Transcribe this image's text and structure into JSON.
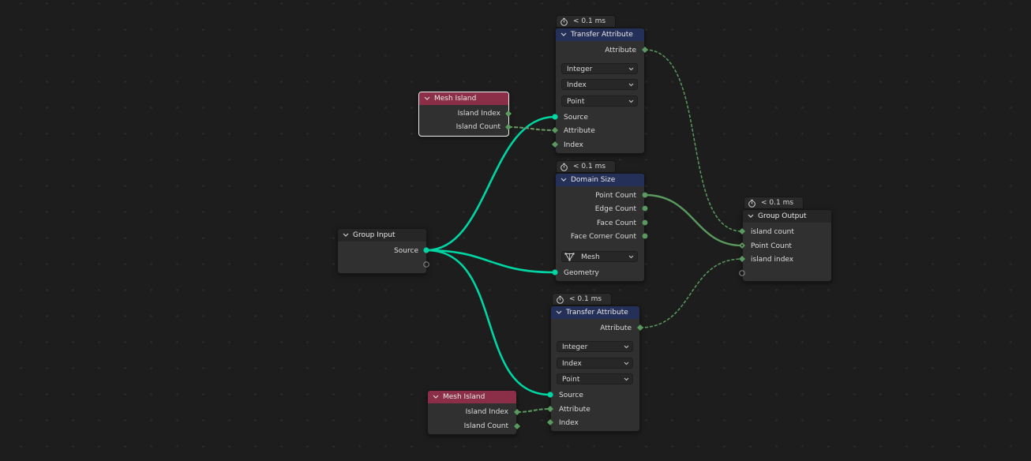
{
  "colors": {
    "geometry_socket": "#00d6a3",
    "int_socket": "#5a9a5e",
    "link_int": "#5a9a5e",
    "link_geometry": "#00d6a3",
    "header_blue": "#243057",
    "header_red": "#8a2f47"
  },
  "nodes": {
    "transfer_top": {
      "timer": "< 0.1 ms",
      "title": "Transfer Attribute",
      "output": "Attribute",
      "dropdowns": [
        "Integer",
        "Index",
        "Point"
      ],
      "inputs": [
        "Source",
        "Attribute",
        "Index"
      ]
    },
    "mesh_island_top": {
      "title": "Mesh Island",
      "outputs": [
        "Island Index",
        "Island Count"
      ]
    },
    "domain_size": {
      "timer": "< 0.1 ms",
      "title": "Domain Size",
      "outputs": [
        "Point Count",
        "Edge Count",
        "Face Count",
        "Face Corner Count"
      ],
      "dropdown": "Mesh",
      "dropdown_icon": "mesh-icon",
      "input": "Geometry"
    },
    "group_output": {
      "timer": "< 0.1 ms",
      "title": "Group Output",
      "inputs": [
        "island count",
        "Point Count",
        "island index"
      ]
    },
    "group_input": {
      "title": "Group Input",
      "outputs": [
        "Source"
      ]
    },
    "transfer_bottom": {
      "timer": "< 0.1 ms",
      "title": "Transfer Attribute",
      "output": "Attribute",
      "dropdowns": [
        "Integer",
        "Index",
        "Point"
      ],
      "inputs": [
        "Source",
        "Attribute",
        "Index"
      ]
    },
    "mesh_island_bottom": {
      "title": "Mesh Island",
      "outputs": [
        "Island Index",
        "Island Count"
      ]
    }
  }
}
